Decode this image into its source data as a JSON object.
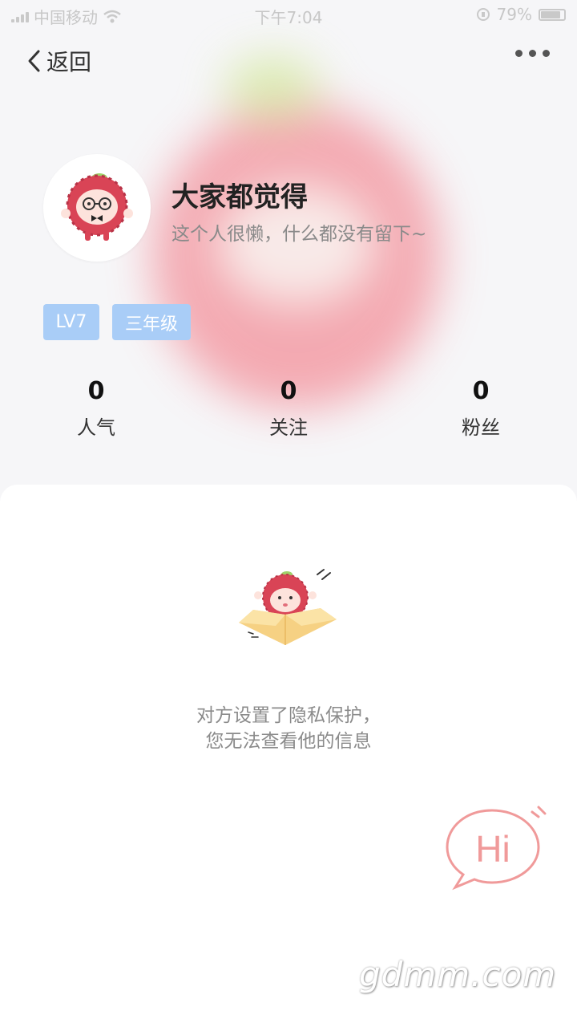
{
  "status_bar": {
    "carrier": "中国移动",
    "time": "下午7:04",
    "battery": "79%"
  },
  "nav": {
    "back_label": "返回"
  },
  "profile": {
    "username": "大家都觉得",
    "bio": "这个人很懒，什么都没有留下~",
    "tags": [
      "LV7",
      "三年级"
    ]
  },
  "stats": [
    {
      "value": "0",
      "label": "人气"
    },
    {
      "value": "0",
      "label": "关注"
    },
    {
      "value": "0",
      "label": "粉丝"
    }
  ],
  "privacy": {
    "line1": "对方设置了隐私保护，",
    "line2": "您无法查看他的信息"
  },
  "hi_button": {
    "label": "Hi"
  },
  "watermark": "gdmm.com",
  "colors": {
    "tag_bg": "#a9cdf7",
    "hi_pink": "#f09a9a",
    "mascot_red": "#e2475a"
  }
}
